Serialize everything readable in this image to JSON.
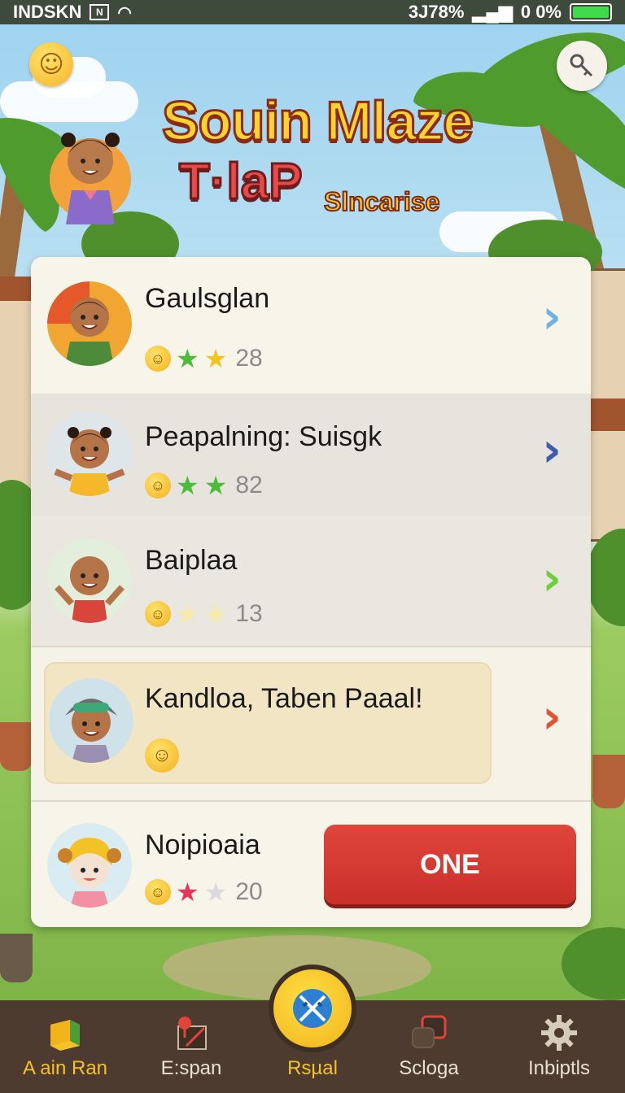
{
  "status_bar": {
    "carrier": "INDSKN",
    "time_battery_text": "3J78%",
    "battery_percent_text": "0 0%"
  },
  "header": {
    "title_line1": "Souin Mlaze",
    "title_line2": "T·laP",
    "title_sub": "Slncarise"
  },
  "players": [
    {
      "name": "Gaulsglan",
      "stars": [
        "green",
        "yellow"
      ],
      "count": "28",
      "chevron_color": "#6fb3e0"
    },
    {
      "name": "Peapalning: Suisgk",
      "stars": [
        "green",
        "green"
      ],
      "count": "82",
      "chevron_color": "#3b5fb0"
    },
    {
      "name": "Baiplaa",
      "stars": [
        "faded",
        "faded"
      ],
      "count": "13",
      "chevron_color": "#6ccf3b"
    },
    {
      "name": "Kandloa, Taben Paaal!",
      "chevron_color": "#e0552f"
    },
    {
      "name": "Noipioaia",
      "stars": [
        "red",
        "grey"
      ],
      "count": "20"
    }
  ],
  "action_button": {
    "label": "ONE"
  },
  "bottom_nav": {
    "items": [
      {
        "label": "A ain Ran",
        "icon": "cube-icon",
        "active": true
      },
      {
        "label": "E:span",
        "icon": "map-pin-icon",
        "active": false
      },
      {
        "label": "Rsµal",
        "icon": "swords-icon",
        "active": true
      },
      {
        "label": "Scloga",
        "icon": "chat-icon",
        "active": false
      },
      {
        "label": "Inbiptls",
        "icon": "gear-icon",
        "active": false
      }
    ]
  },
  "colors": {
    "accent_red": "#d63a32",
    "nav_bg": "#4c3b2e",
    "nav_active": "#f4c22a"
  }
}
